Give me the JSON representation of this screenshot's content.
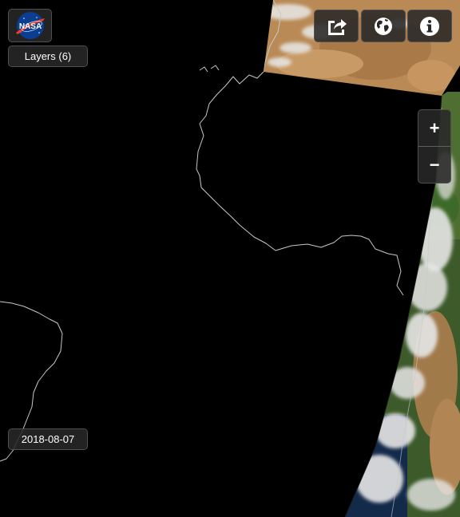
{
  "brand": {
    "logo_text": "NASA"
  },
  "layers": {
    "label": "Layers (6)"
  },
  "toolbar": [
    {
      "name": "share-button",
      "icon": "share-icon"
    },
    {
      "name": "projection-button",
      "icon": "globe-icon"
    },
    {
      "name": "info-button",
      "icon": "info-icon"
    }
  ],
  "zoom": {
    "in_label": "+",
    "out_label": "−"
  },
  "date": {
    "label": "2018-08-07"
  },
  "colors": {
    "background": "#000000",
    "coastline": "#c8c8c8",
    "button_bg": "#282828",
    "desert": "#b98a55",
    "cloud": "#e6e6e6",
    "vegetation": "#5a7a3a"
  }
}
